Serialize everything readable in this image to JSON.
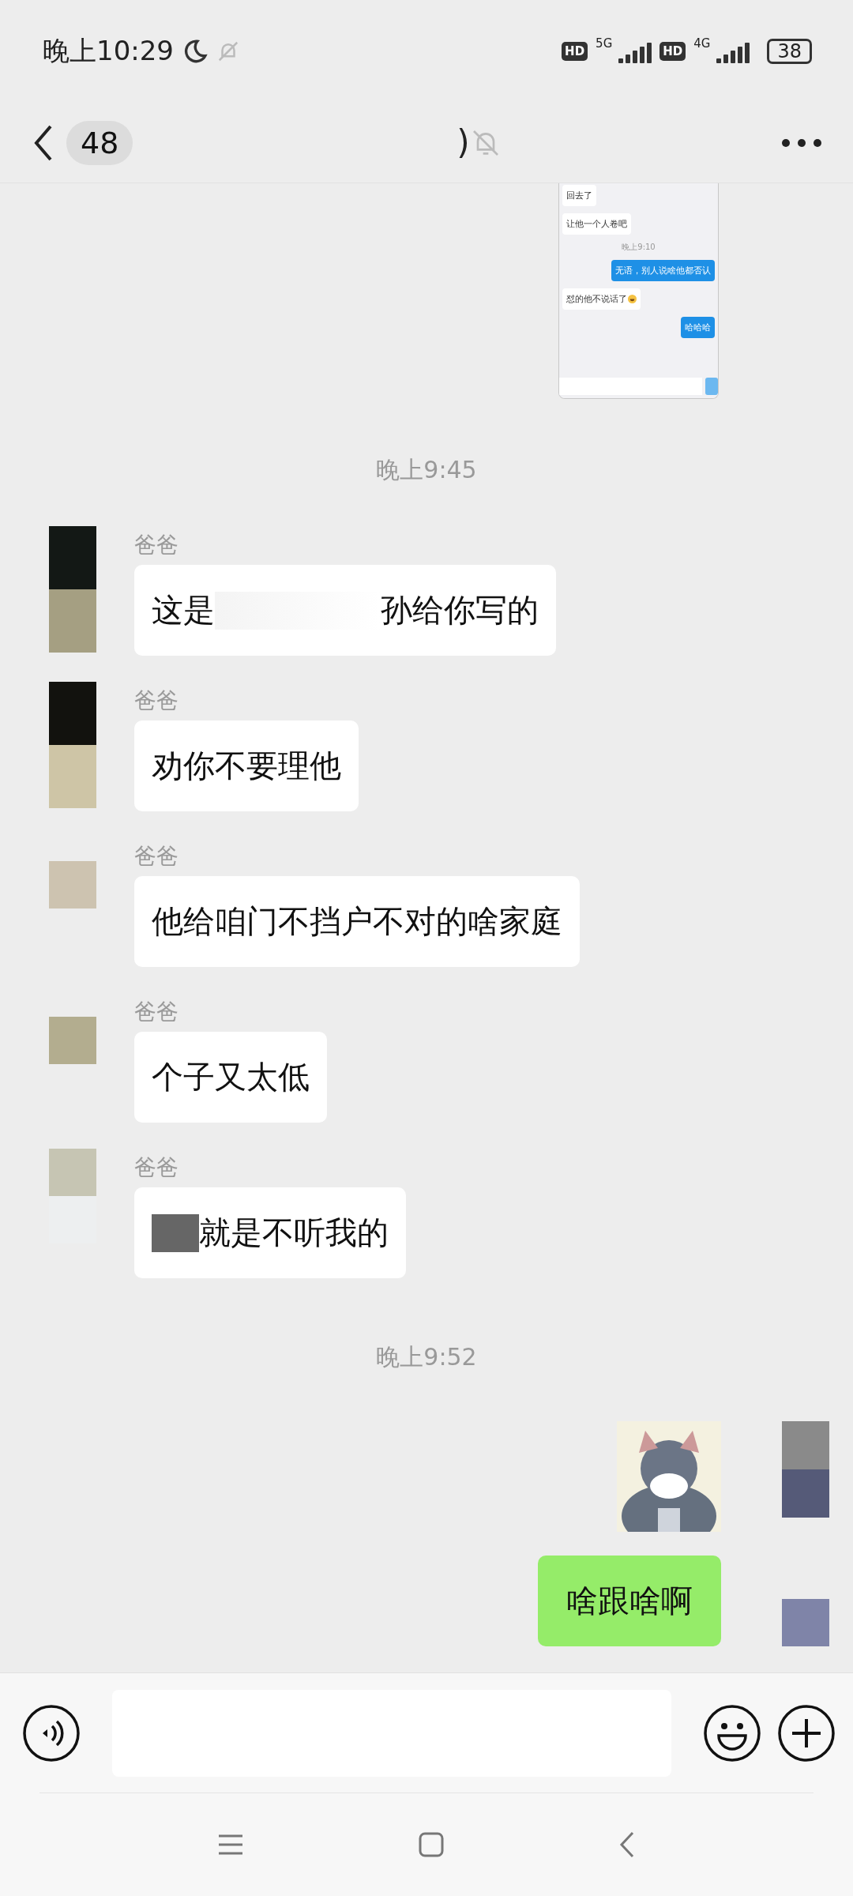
{
  "status_bar": {
    "time": "晚上10:29",
    "do_not_disturb": true,
    "networks": [
      {
        "badge": "HD",
        "type": "5G"
      },
      {
        "badge": "HD",
        "type": "4G"
      }
    ],
    "battery": "38"
  },
  "header": {
    "unread": "48",
    "title": ")",
    "muted": true
  },
  "chat_preview": [
    {
      "kind": "text",
      "outgoing": false,
      "text": "回去了"
    },
    {
      "kind": "text",
      "outgoing": false,
      "text": "让他一个人卷吧"
    },
    {
      "kind": "time",
      "text": "晚上9:10"
    },
    {
      "kind": "text",
      "outgoing": true,
      "text": "无语，别人说啥他都否认"
    },
    {
      "kind": "text",
      "outgoing": false,
      "text": "怼的他不说话了",
      "emoji": true
    },
    {
      "kind": "text",
      "outgoing": true,
      "text": "哈哈哈"
    }
  ],
  "messages": [
    {
      "kind": "time",
      "text": "晚上9:45"
    },
    {
      "kind": "text",
      "outgoing": false,
      "sender": "爸爸",
      "pieces": [
        {
          "kind": "text",
          "text": "这是"
        },
        {
          "kind": "redacted"
        },
        {
          "kind": "text",
          "text": "孙给你写的"
        }
      ]
    },
    {
      "kind": "text",
      "outgoing": false,
      "sender": "爸爸",
      "pieces": [
        {
          "kind": "text",
          "text": "劝你不要理他"
        }
      ]
    },
    {
      "kind": "text",
      "outgoing": false,
      "sender": "爸爸",
      "pieces": [
        {
          "kind": "text",
          "text": "他给咱门不挡户不对的啥家庭"
        }
      ]
    },
    {
      "kind": "text",
      "outgoing": false,
      "sender": "爸爸",
      "pieces": [
        {
          "kind": "text",
          "text": "个子又太低"
        }
      ]
    },
    {
      "kind": "text",
      "outgoing": false,
      "sender": "爸爸",
      "pieces": [
        {
          "kind": "redacted"
        },
        {
          "kind": "text",
          "text": "就是不听我的"
        }
      ]
    },
    {
      "kind": "time",
      "text": "晚上9:52"
    },
    {
      "kind": "sticker"
    },
    {
      "kind": "text",
      "outgoing": true,
      "pieces": [
        {
          "kind": "text",
          "text": "啥跟啥啊"
        }
      ]
    }
  ]
}
